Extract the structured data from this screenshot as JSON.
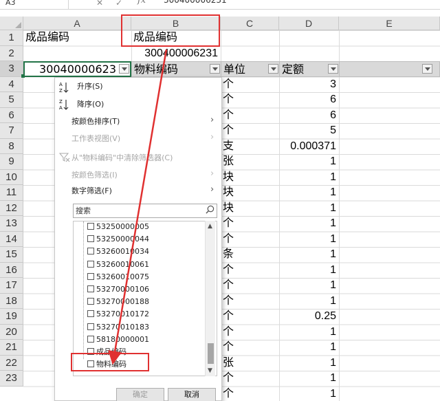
{
  "formula_bar": {
    "name_box": "A3",
    "cancel_glyph": "✕",
    "enter_glyph": "✓",
    "fx_label": "fx",
    "value": "300400006231"
  },
  "columns": [
    "A",
    "B",
    "C",
    "D",
    "E"
  ],
  "rows": [
    "1",
    "2",
    "3",
    "4",
    "5",
    "6",
    "7",
    "8",
    "9",
    "10",
    "11",
    "12",
    "13",
    "14",
    "15",
    "16",
    "17",
    "18",
    "19",
    "20",
    "21",
    "22",
    "23"
  ],
  "cells": {
    "A1": "成品编码",
    "B1": "成品编码",
    "B2": "300400006231",
    "A3": "30040000623",
    "B3": "物料编码",
    "C3": "单位",
    "D3": "定额"
  },
  "column_c": [
    "个",
    "个",
    "个",
    "个",
    "支",
    "张",
    "块",
    "块",
    "块",
    "个",
    "个",
    "条",
    "个",
    "个",
    "个",
    "个",
    "个",
    "个",
    "张",
    "个",
    "个"
  ],
  "column_d": [
    "3",
    "6",
    "6",
    "5",
    "0.000371",
    "1",
    "1",
    "1",
    "1",
    "1",
    "1",
    "1",
    "1",
    "1",
    "1",
    "0.25",
    "1",
    "1",
    "1",
    "1",
    "1"
  ],
  "filter_menu": {
    "sort_asc": "升序(S)",
    "sort_desc": "降序(O)",
    "sort_by_color": "按颜色排序(T)",
    "sheet_view": "工作表视图(V)",
    "clear_filter": "从\"物料编码\"中清除筛选器(C)",
    "filter_by_color": "按颜色筛选(I)",
    "number_filters": "数字筛选(F)",
    "search_placeholder": "搜索",
    "items": [
      "53250000005",
      "53250000044",
      "53260010034",
      "53260010061",
      "53260010075",
      "53270000106",
      "53270000188",
      "53270010172",
      "53270010183",
      "58180000001",
      "成品编码",
      "物料编码"
    ],
    "ok": "确定",
    "cancel": "取消"
  },
  "annotation_color": "#e03030",
  "accent_green": "#217346"
}
